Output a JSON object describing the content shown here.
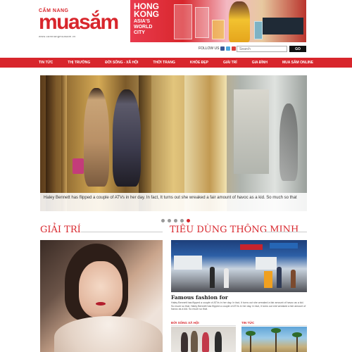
{
  "header": {
    "logo_tag": "CẨM NANG",
    "logo_text": "muasắm",
    "logo_sub": "www.camnangmuasam.vn",
    "banner": {
      "line1": "HONG",
      "line2": "KONG",
      "line3": "ASIA'S",
      "line4": "WORLD",
      "line5": "CITY"
    },
    "follow_label": "FOLLOW US",
    "search_placeholder": "Search",
    "go_label": "GO"
  },
  "nav": {
    "items": [
      "TIN TỨC",
      "THỊ TRƯỜNG",
      "ĐỜI SỐNG - XÃ HỘI",
      "THỜI TRANG",
      "KHỎE ĐẸP",
      "GIẢI TRÍ",
      "GIA ĐÌNH",
      "MUA SẮM ONLINE"
    ]
  },
  "slider": {
    "caption": "Haley Bennett has flipped a couple of ATVs in her day. In fact, It turns out she wreaked a fair amount of havoc as a kid. So much so that",
    "slide_count": 5,
    "active_index": 4
  },
  "sections": {
    "entertainment_title": "GIẢI TRÍ",
    "smart_title": "TIÊU DÙNG THÔNG MINH"
  },
  "article": {
    "title": "Famous fashion for",
    "excerpt": "Haley Bennett has flipped a couple of ATVs in her day. In fact, It turns out she wreaked a fair amount of havoc as a kid. So much so that. Haley Bennett has flipped a couple of ATVs in her day. In fact, it turns out she wreaked a fair amount of havoc as a kid. So much so that."
  },
  "subsections": {
    "left_label": "ĐỜI SỐNG XÃ HỘI",
    "right_label": "TIN TỨC"
  },
  "colors": {
    "brand_red": "#d8262c"
  }
}
